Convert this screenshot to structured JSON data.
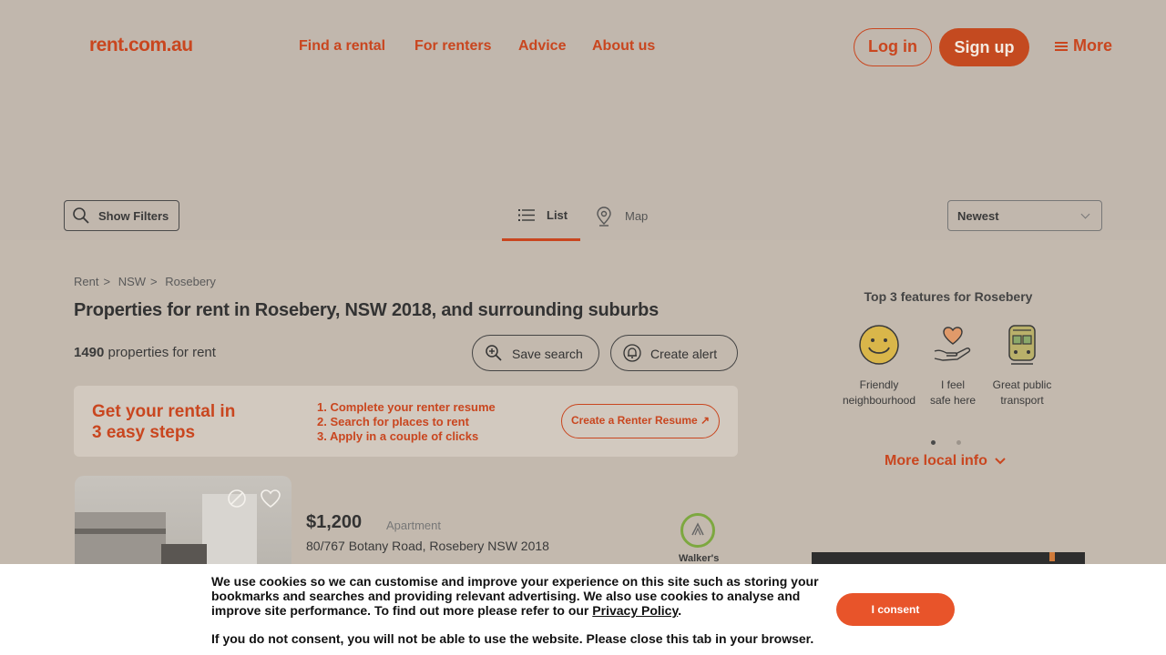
{
  "header": {
    "logo": "rent.com.au",
    "nav": [
      "Find a rental",
      "For renters",
      "Advice",
      "About us"
    ],
    "login": "Log in",
    "signup": "Sign up",
    "more": "More"
  },
  "toolbar": {
    "filters": "Show Filters",
    "list_tab": "List",
    "map_tab": "Map",
    "sort": "Newest"
  },
  "breadcrumb": [
    "Rent",
    "NSW",
    "Rosebery"
  ],
  "breadcrumb_sep": ">",
  "page_title": "Properties for rent in Rosebery, NSW 2018, and surrounding suburbs",
  "results": {
    "count": "1490",
    "suffix": "properties for rent"
  },
  "actions": {
    "save_search": "Save search",
    "create_alert": "Create alert"
  },
  "promo": {
    "heading_line1": "Get your rental in",
    "heading_line2": "3 easy steps",
    "steps": [
      "1. Complete your renter resume",
      "2. Search for places to rent",
      "3. Apply in a couple of clicks"
    ],
    "cta": "Create a Renter Resume ↗"
  },
  "listing": {
    "price": "$1,200",
    "type": "Apartment",
    "address": "80/767 Botany Road, Rosebery NSW 2018",
    "badge": "Walker's"
  },
  "sidebar": {
    "title": "Top 3 features for Rosebery",
    "features": [
      {
        "line1": "Friendly",
        "line2": "neighbourhood",
        "icon": "smiley-icon"
      },
      {
        "line1": "I feel",
        "line2": "safe here",
        "icon": "heart-hand-icon"
      },
      {
        "line1": "Great public",
        "line2": "transport",
        "icon": "train-icon"
      }
    ],
    "more_local": "More local info"
  },
  "cookie": {
    "text_before_link": "We use cookies so we can customise and improve your experience on this site such as storing your bookmarks and searches and providing relevant advertising. We also use cookies to analyse and improve site performance. To find out more please refer to our",
    "link": "Privacy Policy",
    "text_after_link": ".",
    "note": "If you do not consent, you will not be able to use the website. Please close this tab in your browser.",
    "consent": "I consent"
  },
  "colors": {
    "brand": "#c9461f",
    "consent": "#e8542a",
    "walk_ring": "#7da840"
  }
}
